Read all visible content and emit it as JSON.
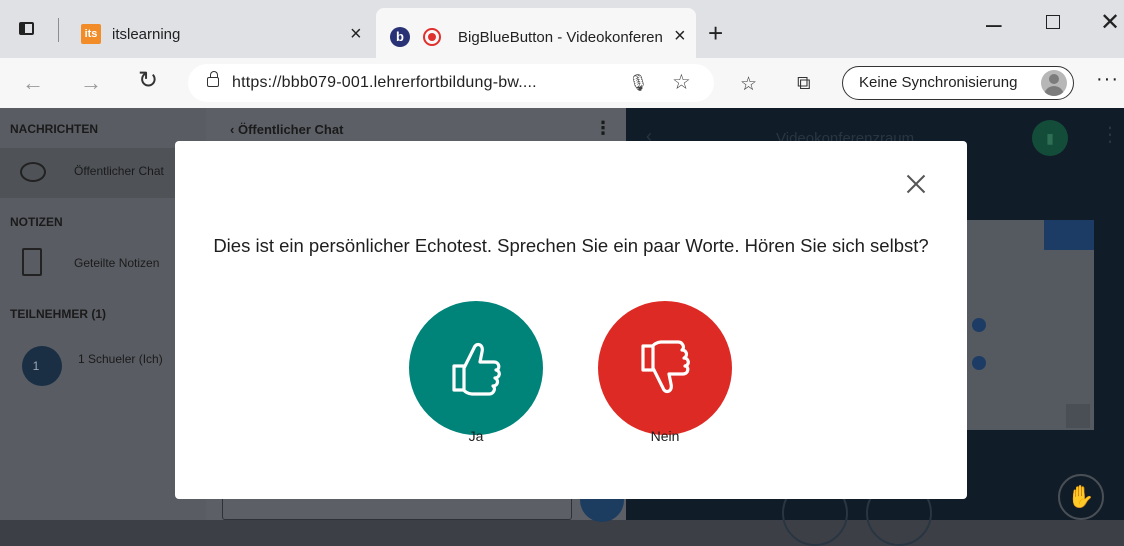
{
  "browser": {
    "tabs": [
      {
        "icon": "its",
        "title": "itslearning"
      },
      {
        "icon": "b",
        "title": "BigBlueButton - Videokonferenz",
        "active": true
      }
    ],
    "address_url": "https://bbb079-001.lehrerfortbildung-bw....",
    "sync_label": "Keine Synchronisierung"
  },
  "sidebar": {
    "messages_title": "NACHRICHTEN",
    "public_chat_label": "Öffentlicher Chat",
    "notes_title": "NOTIZEN",
    "shared_notes_label": "Geteilte Notizen",
    "participants_title": "TEILNEHMER (1)",
    "user_avatar_text": "1",
    "user_name": "1 Schueler (Ich)"
  },
  "chat": {
    "header": "Öffentlicher Chat"
  },
  "video": {
    "room_title": "Videokonferenzraum"
  },
  "modal": {
    "message": "Dies ist ein persönlicher Echotest. Sprechen Sie ein paar Worte. Hören Sie sich selbst?",
    "yes_label": "Ja",
    "no_label": "Nein"
  },
  "colors": {
    "yes_button": "#00847a",
    "no_button": "#dd2a24",
    "brand_bbb": "#283274"
  }
}
